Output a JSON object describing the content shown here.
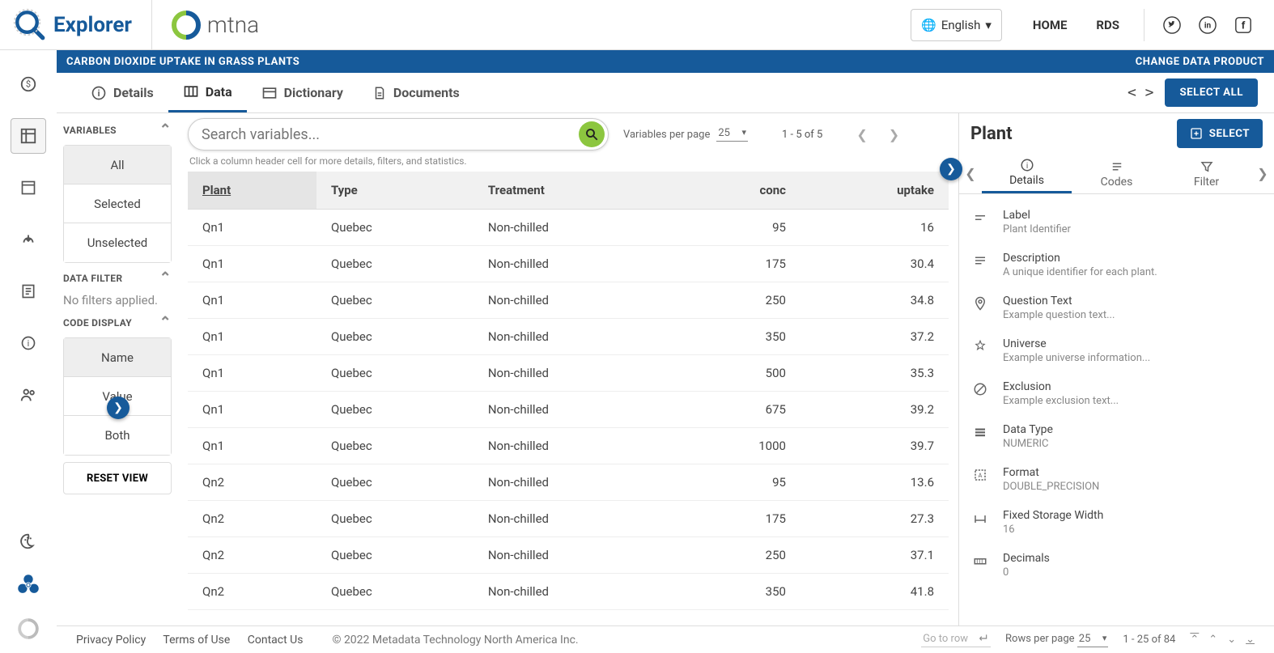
{
  "header": {
    "brand": "Explorer",
    "partner": "mtna",
    "language_label": "English",
    "nav": {
      "home": "HOME",
      "rds": "RDS"
    }
  },
  "product": {
    "title": "CARBON DIOXIDE UPTAKE IN GRASS PLANTS",
    "change_link": "CHANGE DATA PRODUCT"
  },
  "tabs": {
    "details": "Details",
    "data": "Data",
    "dictionary": "Dictionary",
    "documents": "Documents",
    "select_all": "SELECT ALL"
  },
  "sidebar": {
    "variables_title": "VARIABLES",
    "var_filter": {
      "all": "All",
      "selected": "Selected",
      "unselected": "Unselected"
    },
    "data_filter_title": "DATA FILTER",
    "data_filter_empty": "No filters applied.",
    "code_display_title": "CODE DISPLAY",
    "code_display": {
      "name": "Name",
      "value": "Value",
      "both": "Both"
    },
    "reset": "RESET VIEW"
  },
  "search": {
    "placeholder": "Search variables...",
    "vars_per_page_label": "Variables per page",
    "vars_per_page_value": "25",
    "range": "1 - 5 of 5",
    "hint": "Click a column header cell for more details, filters, and statistics."
  },
  "table": {
    "columns": {
      "plant": "Plant",
      "type": "Type",
      "treatment": "Treatment",
      "conc": "conc",
      "uptake": "uptake"
    },
    "rows": [
      {
        "plant": "Qn1",
        "type": "Quebec",
        "treatment": "Non-chilled",
        "conc": "95",
        "uptake": "16"
      },
      {
        "plant": "Qn1",
        "type": "Quebec",
        "treatment": "Non-chilled",
        "conc": "175",
        "uptake": "30.4"
      },
      {
        "plant": "Qn1",
        "type": "Quebec",
        "treatment": "Non-chilled",
        "conc": "250",
        "uptake": "34.8"
      },
      {
        "plant": "Qn1",
        "type": "Quebec",
        "treatment": "Non-chilled",
        "conc": "350",
        "uptake": "37.2"
      },
      {
        "plant": "Qn1",
        "type": "Quebec",
        "treatment": "Non-chilled",
        "conc": "500",
        "uptake": "35.3"
      },
      {
        "plant": "Qn1",
        "type": "Quebec",
        "treatment": "Non-chilled",
        "conc": "675",
        "uptake": "39.2"
      },
      {
        "plant": "Qn1",
        "type": "Quebec",
        "treatment": "Non-chilled",
        "conc": "1000",
        "uptake": "39.7"
      },
      {
        "plant": "Qn2",
        "type": "Quebec",
        "treatment": "Non-chilled",
        "conc": "95",
        "uptake": "13.6"
      },
      {
        "plant": "Qn2",
        "type": "Quebec",
        "treatment": "Non-chilled",
        "conc": "175",
        "uptake": "27.3"
      },
      {
        "plant": "Qn2",
        "type": "Quebec",
        "treatment": "Non-chilled",
        "conc": "250",
        "uptake": "37.1"
      },
      {
        "plant": "Qn2",
        "type": "Quebec",
        "treatment": "Non-chilled",
        "conc": "350",
        "uptake": "41.8"
      }
    ]
  },
  "right": {
    "title": "Plant",
    "select_label": "SELECT",
    "tabs": {
      "details": "Details",
      "codes": "Codes",
      "filter": "Filter"
    },
    "details": [
      {
        "label": "Label",
        "value": "Plant Identifier"
      },
      {
        "label": "Description",
        "value": "A unique identifier for each plant."
      },
      {
        "label": "Question Text",
        "value": "Example question text..."
      },
      {
        "label": "Universe",
        "value": "Example universe information..."
      },
      {
        "label": "Exclusion",
        "value": "Example exclusion text..."
      },
      {
        "label": "Data Type",
        "value": "NUMERIC"
      },
      {
        "label": "Format",
        "value": "DOUBLE_PRECISION"
      },
      {
        "label": "Fixed Storage Width",
        "value": "16"
      },
      {
        "label": "Decimals",
        "value": "0"
      }
    ]
  },
  "footer": {
    "links": {
      "privacy": "Privacy Policy",
      "terms": "Terms of Use",
      "contact": "Contact Us"
    },
    "copyright": "© 2022 Metadata Technology North America Inc.",
    "goto": "Go to row",
    "rows_per_page_label": "Rows per page",
    "rows_per_page_value": "25",
    "range": "1 - 25 of 84"
  }
}
